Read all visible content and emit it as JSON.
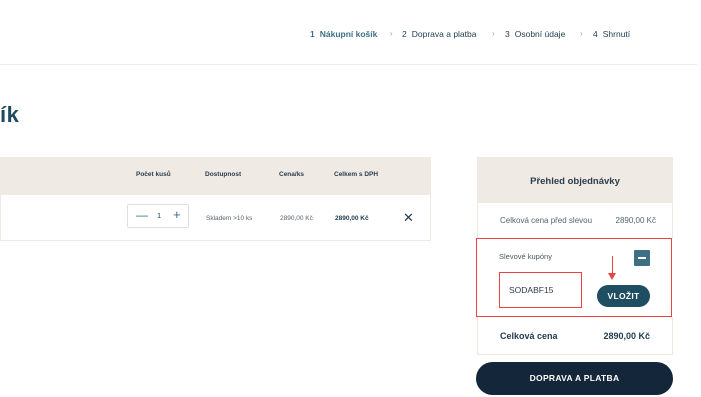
{
  "steps": [
    {
      "num": "1",
      "label": "Nákupní košík",
      "active": true
    },
    {
      "num": "2",
      "label": "Doprava a platba",
      "active": false
    },
    {
      "num": "3",
      "label": "Osobní údaje",
      "active": false
    },
    {
      "num": "4",
      "label": "Shrnutí",
      "active": false
    }
  ],
  "page_title": "ík",
  "table": {
    "columns": [
      "Počet kusů",
      "Dostupnost",
      "Cena/ks",
      "Celkem s DPH"
    ],
    "row": {
      "quantity": "1",
      "availability": "Skladem >10 ks",
      "unit_price": "2890,00 Kč",
      "total": "2890,00 Kč"
    }
  },
  "summary": {
    "title": "Přehled objednávky",
    "price_before_discount_label": "Celková cena před slevou",
    "price_before_discount_value": "2890,00 Kč",
    "coupon_label": "Slevové kupóny",
    "coupon_value": "SODABF15",
    "apply_label": "VLOŽIT",
    "total_label": "Celková cena",
    "total_value": "2890,00 Kč"
  },
  "continue_label": "DOPRAVA A PLATBA",
  "icons": {
    "chevron": "›",
    "minus": "—",
    "plus": "+",
    "remove": "✕"
  },
  "colors": {
    "accent": "#3d6f86",
    "primary_dark": "#14263a",
    "highlight_red": "#e64444",
    "panel_bg": "#efeae4"
  }
}
